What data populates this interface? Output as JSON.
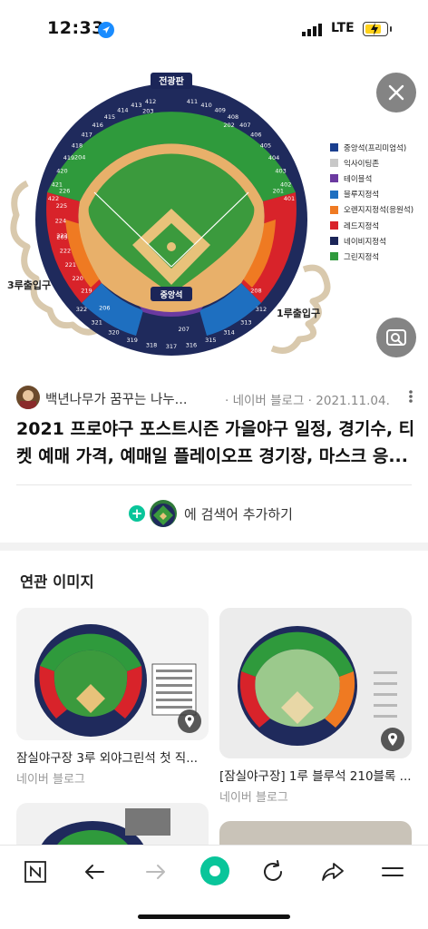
{
  "status_bar": {
    "time": "12:33",
    "network": "LTE"
  },
  "hero": {
    "scoreboard_label": "전광판",
    "home_label": "중앙석",
    "gate3_label": "3루출입구",
    "gate1_label": "1루출입구",
    "legend": [
      {
        "label": "중앙석(프리미엄석)",
        "color": "#1a3f8f"
      },
      {
        "label": "익사이팅존",
        "color": "#c8c8c8"
      },
      {
        "label": "테이블석",
        "color": "#6b3aa0"
      },
      {
        "label": "블루지정석",
        "color": "#1e6fc0"
      },
      {
        "label": "오렌지지정석(응원석)",
        "color": "#ef7a22"
      },
      {
        "label": "레드지정석",
        "color": "#d8232a"
      },
      {
        "label": "네이비지정석",
        "color": "#1b2558"
      },
      {
        "label": "그린지정석",
        "color": "#2f9a3c"
      }
    ],
    "outer_sections_left": [
      "412",
      "413",
      "414",
      "415",
      "416",
      "417",
      "418",
      "419",
      "420",
      "421",
      "422"
    ],
    "outer_sections_right": [
      "411",
      "410",
      "409",
      "408",
      "407",
      "406",
      "405",
      "404",
      "403",
      "402",
      "401"
    ],
    "red_left": [
      "226",
      "225",
      "224",
      "223",
      "222",
      "221",
      "220",
      "219"
    ],
    "red_right": [
      "201",
      "202",
      "203",
      "204",
      "205",
      "206",
      "207",
      "208"
    ],
    "navy_bottom": [
      "322",
      "321",
      "320",
      "319",
      "318",
      "317",
      "316",
      "315",
      "314",
      "313",
      "312"
    ]
  },
  "result": {
    "author": "백년나무가 꿈꾸는 나누...",
    "source": "· 네이버 블로그 · 2021.11.04.",
    "title": "2021 프로야구 포스트시즌 가을야구 일정, 경기수, 티켓 예매 가격, 예매일 플레이오프 경기장, 마스크 응..."
  },
  "add_search": {
    "text": "에 검색어 추가하기"
  },
  "related": {
    "heading": "연관 이미지",
    "cards": [
      {
        "caption": "잠실야구장 3루 외야그린석 첫 직...",
        "source": "네이버 블로그"
      },
      {
        "caption": "[잠실야구장] 1루 블루석 210블록 ...",
        "source": "네이버 블로그"
      }
    ]
  },
  "colors": {
    "field_green": "#3b9a3d",
    "infield": "#e8c27a",
    "accent_green": "#09c59a"
  }
}
